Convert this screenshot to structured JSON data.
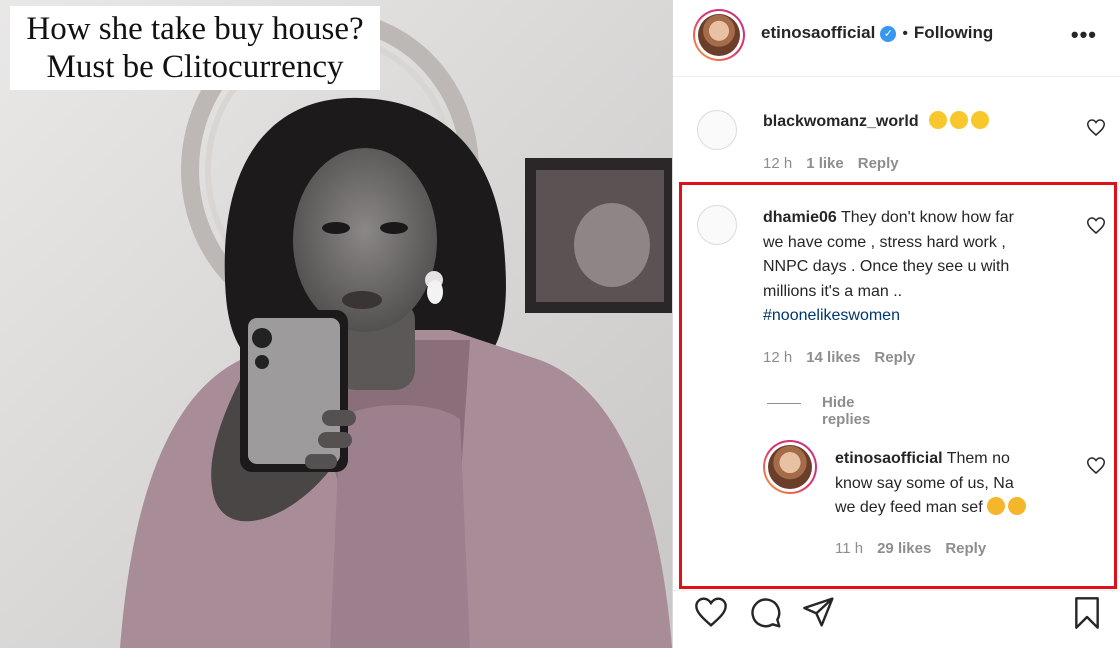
{
  "meme": {
    "caption_line1": "How she take buy house?",
    "caption_line2": "Must be Clitocurrency"
  },
  "header": {
    "username": "etinosaofficial",
    "verified_icon": "✓",
    "separator": "•",
    "following_label": "Following",
    "more_icon": "•••"
  },
  "comments": [
    {
      "username": "blackwomanz_world",
      "emojis": [
        "star-struck",
        "star-struck",
        "star-struck"
      ],
      "time": "12 h",
      "likes": "1 like",
      "reply_label": "Reply"
    },
    {
      "username": "dhamie06",
      "text_line1": "They don't know how far",
      "text_line2": "we have come , stress hard work ,",
      "text_line3": "NNPC days . Once they see u with",
      "text_line4": "millions it's a man ..",
      "hashtag": "#noonelikeswomen",
      "time": "12 h",
      "likes": "14 likes",
      "reply_label": "Reply",
      "hide_replies_label": "Hide replies"
    }
  ],
  "reply": {
    "username": "etinosaofficial",
    "text_line1": "Them no",
    "text_line2": "know say some of us, Na",
    "text_line3": "we dey feed man sef",
    "emojis": [
      "disappointed-face",
      "disappointed-face"
    ],
    "time": "11 h",
    "likes": "29 likes",
    "reply_label": "Reply"
  },
  "colors": {
    "highlight_border": "#e0101a",
    "verified_blue": "#3897f0",
    "hashtag_blue": "#00376b",
    "meta_grey": "#8e8e8e"
  }
}
